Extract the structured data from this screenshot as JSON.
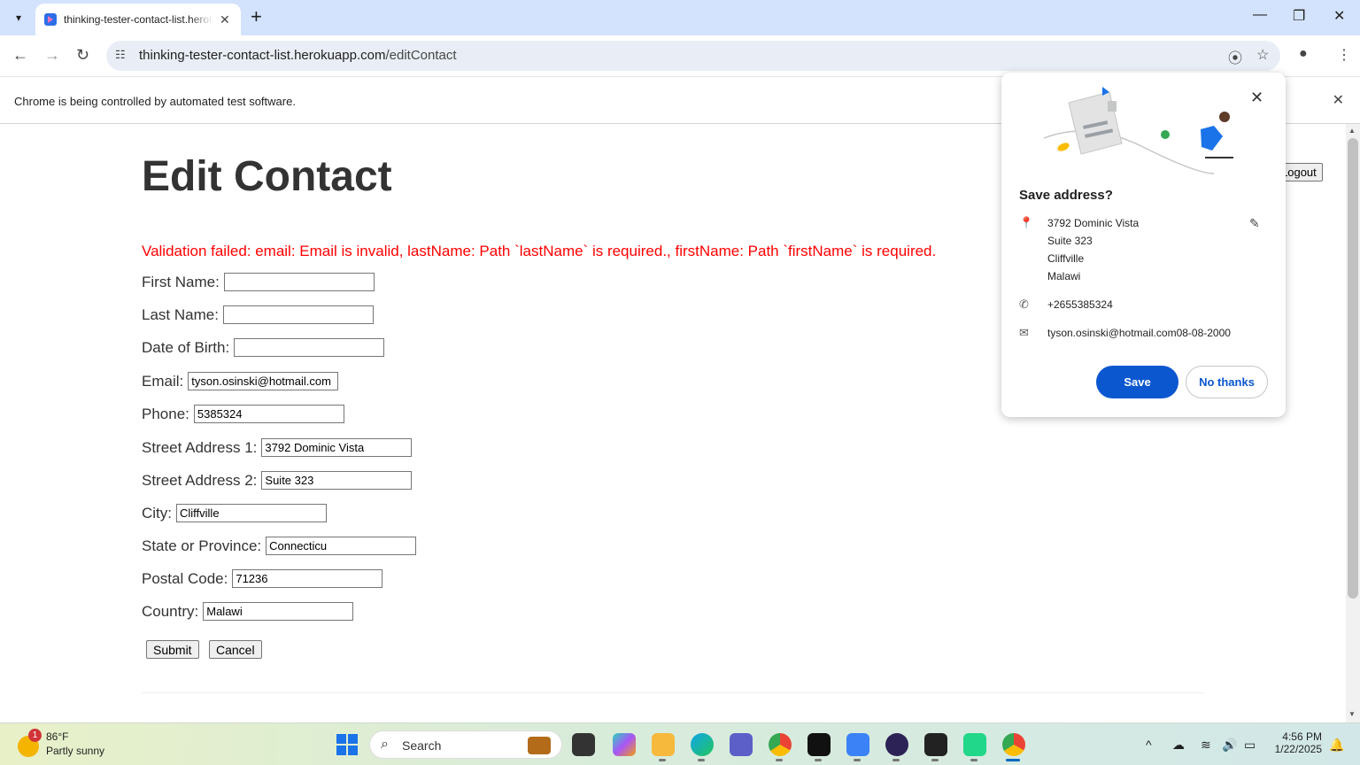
{
  "browser": {
    "tab_title": "thinking-tester-contact-list.herokuapp.com/editContact",
    "url_host": "thinking-tester-contact-list.herokuapp.com",
    "url_path": "/editContact",
    "infobar_message": "Chrome is being controlled by automated test software."
  },
  "page": {
    "title": "Edit Contact",
    "logout_label": "Logout",
    "error": "Validation failed: email: Email is invalid, lastName: Path `lastName` is required., firstName: Path `firstName` is required.",
    "fields": [
      {
        "label": "First Name:",
        "value": ""
      },
      {
        "label": "Last Name:",
        "value": ""
      },
      {
        "label": "Date of Birth:",
        "value": ""
      },
      {
        "label": "Email:",
        "value": "tyson.osinski@hotmail.com"
      },
      {
        "label": "Phone:",
        "value": "5385324"
      },
      {
        "label": "Street Address 1:",
        "value": "3792 Dominic Vista"
      },
      {
        "label": "Street Address 2:",
        "value": "Suite 323"
      },
      {
        "label": "City:",
        "value": "Cliffville"
      },
      {
        "label": "State or Province:",
        "value": "Connecticu"
      },
      {
        "label": "Postal Code:",
        "value": "71236"
      },
      {
        "label": "Country:",
        "value": "Malawi"
      }
    ],
    "submit_label": "Submit",
    "cancel_label": "Cancel"
  },
  "popup": {
    "title": "Save address?",
    "address_lines": [
      "3792 Dominic Vista",
      "Suite 323",
      "Cliffville",
      "Malawi"
    ],
    "phone": "+2655385324",
    "email": "tyson.osinski@hotmail.com08-08-2000",
    "save_label": "Save",
    "no_thanks_label": "No thanks"
  },
  "taskbar": {
    "weather_temp": "86°F",
    "weather_condition": "Partly sunny",
    "weather_badge": "1",
    "search_label": "Search",
    "time": "4:56 PM",
    "date": "1/22/2025"
  },
  "colors": {
    "error": "#ff0000",
    "save_button": "#0b57d0",
    "tabstrip": "#d3e3fd"
  }
}
